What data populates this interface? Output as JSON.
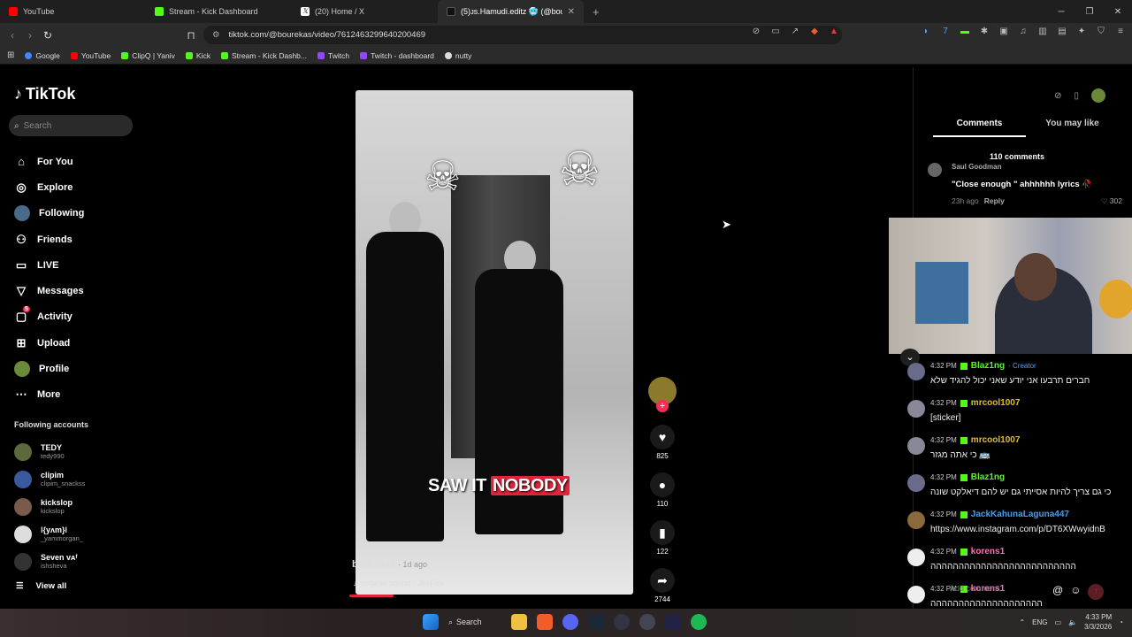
{
  "browser": {
    "tabs": [
      {
        "label": "YouTube",
        "color": "#ff0000",
        "active": false
      },
      {
        "label": "Stream - Kick Dashboard",
        "color": "#53fc18",
        "active": false
      },
      {
        "label": "(20) Home / X",
        "color": "#000000",
        "active": false
      },
      {
        "label": "(5)ᴊs.Hamudi.editz 🥶 (@bourek",
        "color": "#111111",
        "active": true
      }
    ],
    "url": "tiktok.com/@bourekas/video/7612463299640200469",
    "bookmarks": [
      "Google",
      "YouTube",
      "ClipQ | Yaniv",
      "Kick",
      "Stream - Kick Dashb...",
      "Twitch",
      "Twitch - dashboard",
      "nutty"
    ]
  },
  "sidebar": {
    "logo": "TikTok",
    "search_placeholder": "Search",
    "menu": [
      {
        "label": "For You",
        "icon": "home-icon"
      },
      {
        "label": "Explore",
        "icon": "compass-icon"
      },
      {
        "label": "Following",
        "icon": "following-icon"
      },
      {
        "label": "Friends",
        "icon": "friends-icon"
      },
      {
        "label": "LIVE",
        "icon": "live-icon"
      },
      {
        "label": "Messages",
        "icon": "messages-icon"
      },
      {
        "label": "Activity",
        "icon": "activity-icon",
        "badge": "5"
      },
      {
        "label": "Upload",
        "icon": "upload-icon"
      },
      {
        "label": "Profile",
        "icon": "profile-icon"
      },
      {
        "label": "More",
        "icon": "more-icon"
      }
    ],
    "following_title": "Following accounts",
    "following": [
      {
        "name": "TEDY",
        "handle": "tedy990"
      },
      {
        "name": "clipim",
        "handle": "clipim_snackss"
      },
      {
        "name": "kickslop",
        "handle": "kickslop"
      },
      {
        "name": "ǀ{yʌm}ǀ",
        "handle": "_yammorgan_"
      },
      {
        "name": "Seven ᴠᴀᶠ",
        "handle": "ishsheva"
      }
    ],
    "view_all": "View all"
  },
  "video": {
    "caption_a": "SAW IT",
    "caption_b": "NOBODY",
    "author": "bourekas",
    "age": "· 1d ago",
    "sound": "♫ original sound - JexFtbl",
    "progress": 0.16,
    "likes": "825",
    "comments": "110",
    "saves": "122",
    "shares": "2744"
  },
  "comments_panel": {
    "tab_comments": "Comments",
    "tab_may_like": "You may like",
    "count": "110 comments",
    "first_comment": {
      "author": "Saul Goodman",
      "text": "\"Close enough \" ahhhhhh lyrics 🥀",
      "time": "23h ago",
      "reply": "Reply",
      "likes": "♡ 302"
    },
    "add_comment": "Add comment..."
  },
  "chat": [
    {
      "time": "4:32 PM",
      "user": "Blaz1ng",
      "user_color": "#53fc18",
      "extra": "· Creator",
      "text": "חברים תרבעו אני יודע שאני יכול להגיד שלא"
    },
    {
      "time": "4:32 PM",
      "user": "mrcool1007",
      "user_color": "#e0c020",
      "extra": "",
      "text": "[sticker]"
    },
    {
      "time": "4:32 PM",
      "user": "mrcool1007",
      "user_color": "#e0c020",
      "extra": "",
      "text": "כי אתה מגזר 🚌"
    },
    {
      "time": "4:32 PM",
      "user": "Blaz1ng",
      "user_color": "#53fc18",
      "extra": "",
      "text": "כי גם צריך להיות אסייתי גם יש להם דיאלקט שונה"
    },
    {
      "time": "4:32 PM",
      "user": "JackKahunaLaguna447",
      "user_color": "#3aa0ff",
      "extra": "",
      "text": "https://www.instagram.com/p/DT6XWwyidnB"
    },
    {
      "time": "4:32 PM",
      "user": "korens1",
      "user_color": "#ff6fb5",
      "extra": "",
      "text": "הההההההההההההההההההההההההה"
    },
    {
      "time": "4:32 PM",
      "user": "korens1",
      "user_color": "#ff6fb5",
      "extra": "",
      "text": "הההההההההההההההההההה"
    }
  ],
  "taskbar": {
    "search": "Search",
    "lang": "ENG",
    "time": "4:33 PM",
    "date": "3/3/2026"
  }
}
